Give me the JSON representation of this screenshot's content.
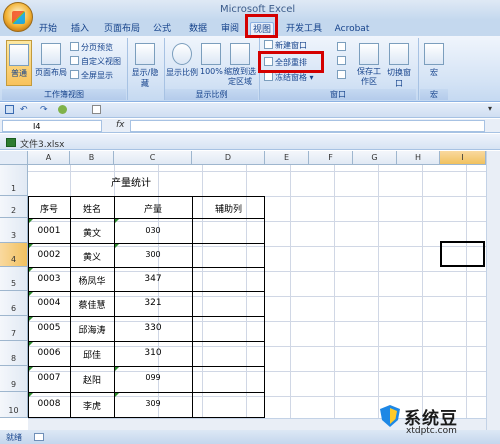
{
  "window": {
    "title": "Microsoft Excel"
  },
  "tabs": [
    {
      "label": "开始"
    },
    {
      "label": "插入"
    },
    {
      "label": "页面布局"
    },
    {
      "label": "公式"
    },
    {
      "label": "数据"
    },
    {
      "label": "审阅"
    },
    {
      "label": "视图"
    },
    {
      "label": "开发工具"
    },
    {
      "label": "Acrobat"
    }
  ],
  "active_tab": "视图",
  "ribbon": {
    "workbook_views": {
      "group_label": "工作簿视图",
      "normal": "普通",
      "page_layout": "页面布局",
      "page_break_preview": "分页预览",
      "custom_views": "自定义视图",
      "full_screen": "全屏显示"
    },
    "show_hide": {
      "label": "显示/隐藏"
    },
    "zoom": {
      "group_label": "显示比例",
      "zoom": "显示比例",
      "hundred": "100%",
      "zoom_to_selection": "缩放到选定区域"
    },
    "window": {
      "group_label": "窗口",
      "new_window": "新建窗口",
      "arrange_all": "全部重排",
      "freeze_panes": "冻结窗格",
      "save_workspace": "保存工作区",
      "switch_windows": "切换窗口"
    },
    "macros": {
      "group_label": "宏",
      "macros": "宏"
    }
  },
  "formula_bar": {
    "name_box": "I4",
    "fx": "fx",
    "value": ""
  },
  "workbook": {
    "title": "文件3.xlsx"
  },
  "columns": [
    "A",
    "B",
    "C",
    "D",
    "E",
    "F",
    "G",
    "H",
    "I"
  ],
  "selected_column": "I",
  "rows": [
    "1",
    "2",
    "3",
    "4",
    "5",
    "6",
    "7",
    "8",
    "9",
    "10"
  ],
  "selected_row": "4",
  "sheet": {
    "title": "产量统计",
    "headers": [
      "序号",
      "姓名",
      "产量",
      "辅助列"
    ],
    "records": [
      {
        "id": "0001",
        "name": "黄文",
        "output": "030"
      },
      {
        "id": "0002",
        "name": "黄义",
        "output": "300"
      },
      {
        "id": "0003",
        "name": "杨凤华",
        "output": "347"
      },
      {
        "id": "0004",
        "name": "蔡佳慧",
        "output": "321"
      },
      {
        "id": "0005",
        "name": "邱海涛",
        "output": "330"
      },
      {
        "id": "0006",
        "name": "邱佳",
        "output": "310"
      },
      {
        "id": "0007",
        "name": "赵阳",
        "output": "099"
      },
      {
        "id": "0008",
        "name": "李虎",
        "output": "309"
      }
    ]
  },
  "status": {
    "ready": "就绪"
  },
  "watermark": {
    "brand": "系统豆",
    "url": "xtdptc.com"
  },
  "colors": {
    "highlight": "#d40000",
    "ribbon": "#c4d8ee",
    "active_row_header": "#f1c15f"
  }
}
